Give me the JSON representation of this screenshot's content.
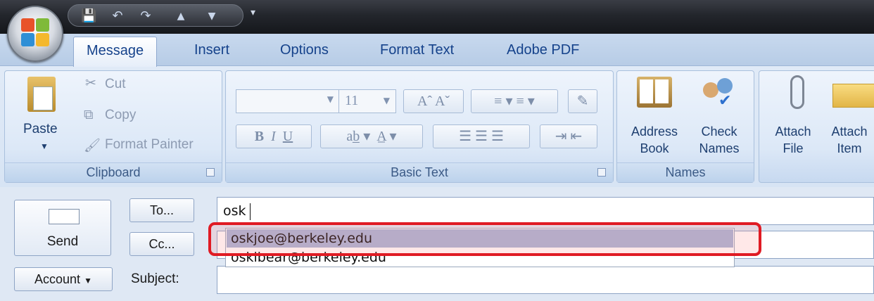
{
  "qat": {
    "icons": [
      "save-icon",
      "undo-icon",
      "redo-icon",
      "up-arrow-icon",
      "down-arrow-icon",
      "customize-dropdown-icon"
    ]
  },
  "ribbon": {
    "tabs": [
      "Message",
      "Insert",
      "Options",
      "Format Text",
      "Adobe PDF"
    ],
    "active_tab": "Message",
    "clipboard": {
      "paste": "Paste",
      "cut": "Cut",
      "copy": "Copy",
      "format_painter": "Format Painter",
      "label": "Clipboard"
    },
    "basic_text": {
      "font_size": "11",
      "bold": "B",
      "italic": "I",
      "underline": "U",
      "label": "Basic Text"
    },
    "names": {
      "address_book_1": "Address",
      "address_book_2": "Book",
      "check_names_1": "Check",
      "check_names_2": "Names",
      "label": "Names"
    },
    "include": {
      "attach_file_1": "Attach",
      "attach_file_2": "File",
      "attach_item_1": "Attach",
      "attach_item_2": "Item"
    }
  },
  "compose": {
    "send": "Send",
    "to_button": "To...",
    "cc_button": "Cc...",
    "account_button": "Account",
    "subject_label": "Subject:",
    "to_value": "osk",
    "autocomplete": [
      "oskjoe@berkeley.edu",
      "oskibear@berkeley.edu"
    ]
  },
  "colors": {
    "accent": "#15428b",
    "highlight": "#e01b24",
    "selected": "#a8b6d8"
  }
}
